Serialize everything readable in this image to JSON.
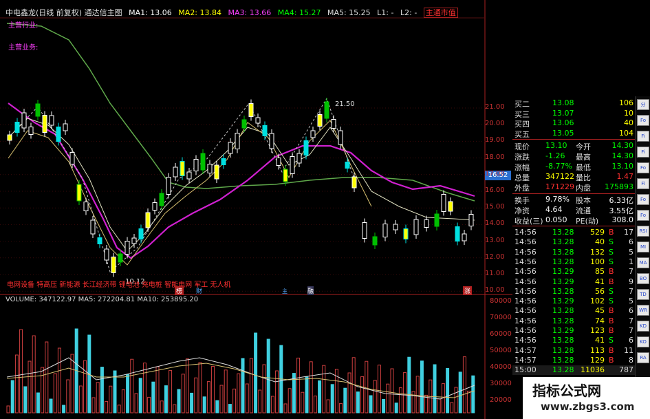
{
  "title_bar": {
    "name": "中电鑫龙(日线 前复权) 通达信主图",
    "ma1": "MA1: 13.06",
    "ma2": "MA2: 13.84",
    "ma3": "MA3: 13.66",
    "ma4": "MA4: 15.27",
    "ma5": "MA5: 15.25",
    "l1": "L1: -",
    "l2": "L2: -",
    "right_tag": "主通市值"
  },
  "side_labels": {
    "line1": "主营行业:",
    "line2": "主营业务:"
  },
  "annotations": {
    "high": "21.50",
    "low": "10.12",
    "price_marker": "16.52",
    "concepts": "电网设备 特高压 新能源 长江经济带 锂电池 充电桩 智能电网 军工 无人机"
  },
  "markers": [
    "榜",
    "财",
    "主",
    "融",
    "涨"
  ],
  "price_axis": [
    "21.00",
    "20.00",
    "19.00",
    "18.00",
    "17.00",
    "16.00",
    "15.00",
    "14.00",
    "13.00",
    "12.00",
    "11.00",
    "10.00"
  ],
  "volume_bar": {
    "text": "VOLUME: 347122.97  MA5: 272204.81  MA10: 253895.20"
  },
  "volume_axis": [
    "80000",
    "70000",
    "60000",
    "50000",
    "40000",
    "30000",
    "20000"
  ],
  "quote": {
    "bids": [
      {
        "label": "买二",
        "price": "13.08",
        "vol": "106"
      },
      {
        "label": "买三",
        "price": "13.07",
        "vol": "10"
      },
      {
        "label": "买四",
        "price": "13.06",
        "vol": "40"
      },
      {
        "label": "买五",
        "price": "13.05",
        "vol": "104"
      }
    ],
    "stats": [
      {
        "l1": "现价",
        "v1": "13.10",
        "l2": "今开",
        "v2": "14.30",
        "c1": "#00ff00",
        "c2": "#00ff00"
      },
      {
        "l1": "涨跌",
        "v1": "-1.26",
        "l2": "最高",
        "v2": "14.30",
        "c1": "#00ff00",
        "c2": "#00ff00"
      },
      {
        "l1": "涨幅",
        "v1": "-8.77%",
        "l2": "最低",
        "v2": "13.10",
        "c1": "#00ff00",
        "c2": "#00ff00"
      },
      {
        "l1": "总量",
        "v1": "347122",
        "l2": "量比",
        "v2": "1.47",
        "c1": "#ffff00",
        "c2": "#ff3030"
      },
      {
        "l1": "外盘",
        "v1": "171229",
        "l2": "内盘",
        "v2": "175893",
        "c1": "#ff3030",
        "c2": "#00ff00"
      },
      {
        "l1": "换手",
        "v1": "9.78%",
        "l2": "股本",
        "v2": "6.33亿",
        "c1": "#ffffff",
        "c2": "#ffffff"
      },
      {
        "l1": "净资",
        "v1": "4.64",
        "l2": "流通",
        "v2": "3.55亿",
        "c1": "#ffffff",
        "c2": "#ffffff"
      },
      {
        "l1": "收益(三)",
        "v1": "0.050",
        "l2": "PE(动)",
        "v2": "308.0",
        "c1": "#ffffff",
        "c2": "#ffffff"
      }
    ],
    "ticks": [
      {
        "time": "14:56",
        "price": "13.28",
        "vol": "529",
        "bs": "B",
        "n": "17"
      },
      {
        "time": "14:56",
        "price": "13.28",
        "vol": "40",
        "bs": "S",
        "n": "6"
      },
      {
        "time": "14:56",
        "price": "13.28",
        "vol": "132",
        "bs": "S",
        "n": "5"
      },
      {
        "time": "14:56",
        "price": "13.28",
        "vol": "100",
        "bs": "S",
        "n": "1"
      },
      {
        "time": "14:56",
        "price": "13.29",
        "vol": "85",
        "bs": "B",
        "n": "7"
      },
      {
        "time": "14:56",
        "price": "13.29",
        "vol": "41",
        "bs": "B",
        "n": "9"
      },
      {
        "time": "14:56",
        "price": "13.28",
        "vol": "56",
        "bs": "S",
        "n": "7"
      },
      {
        "time": "14:56",
        "price": "13.29",
        "vol": "102",
        "bs": "S",
        "n": "5"
      },
      {
        "time": "14:56",
        "price": "13.28",
        "vol": "45",
        "bs": "B",
        "n": "6"
      },
      {
        "time": "14:56",
        "price": "13.28",
        "vol": "74",
        "bs": "B",
        "n": "7"
      },
      {
        "time": "14:56",
        "price": "13.29",
        "vol": "123",
        "bs": "B",
        "n": "7"
      },
      {
        "time": "14:56",
        "price": "13.28",
        "vol": "41",
        "bs": "S",
        "n": "6"
      },
      {
        "time": "14:57",
        "price": "13.28",
        "vol": "113",
        "bs": "B",
        "n": "11"
      },
      {
        "time": "14:57",
        "price": "13.28",
        "vol": "129",
        "bs": "B",
        "n": "8"
      },
      {
        "time": "15:00",
        "price": "13.28",
        "vol": "11036",
        "bs": "",
        "n": "787"
      }
    ]
  },
  "toolbar": [
    "分",
    "Fo",
    "Fi",
    "Fi",
    "Fo",
    "Fi",
    "Fo",
    "Fo",
    "RSI",
    "MI",
    "MA",
    "BO",
    "TD",
    "WR",
    "KD",
    "KO",
    "RA"
  ],
  "watermark": {
    "title": "指标公式网",
    "url": "www.zbgs3.com"
  }
}
